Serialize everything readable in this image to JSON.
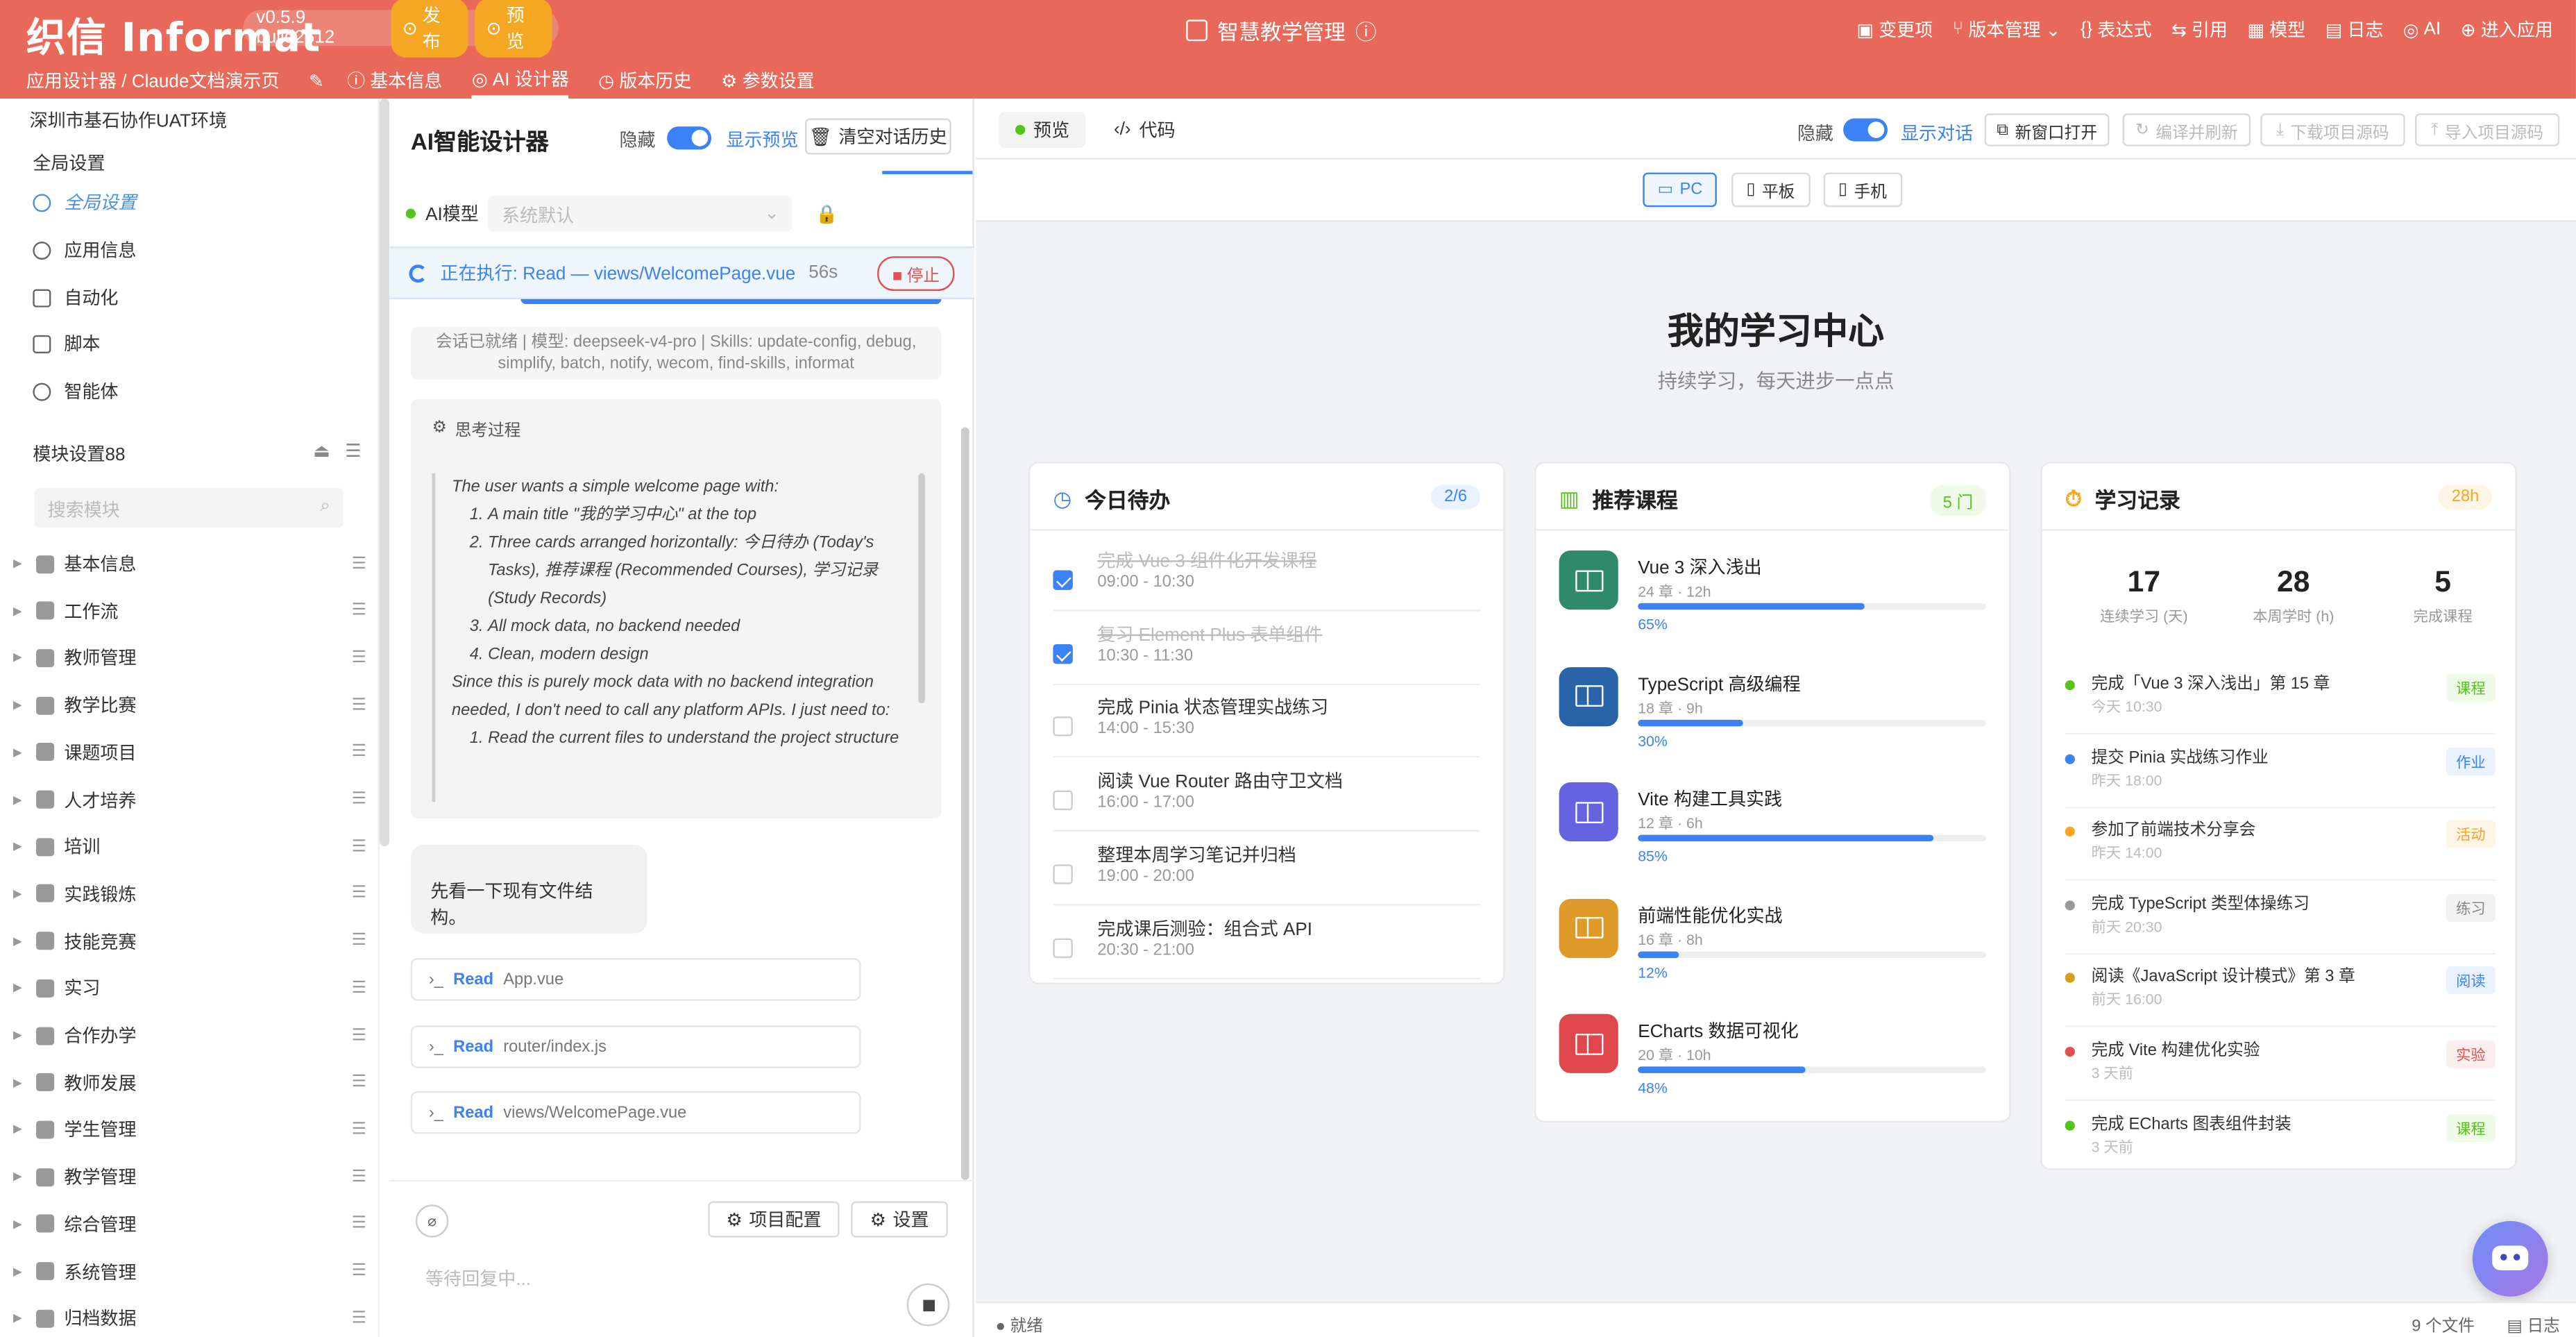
{
  "topbar": {
    "logo": "织信 Informat",
    "version": "v0.5.9 build2512",
    "publish": "发布",
    "preview": "预览",
    "app_title": "智慧教学管理",
    "nav": [
      "变更项",
      "版本管理",
      "表达式",
      "引用",
      "模型",
      "日志",
      "AI",
      "进入应用"
    ],
    "breadcrumb": "应用设计器 / Claude文档演示页",
    "subtabs": [
      "基本信息",
      "AI 设计器",
      "版本历史",
      "参数设置"
    ]
  },
  "sidebar": {
    "env": "深圳市基石协作UAT环境",
    "global_section": "全局设置",
    "items": [
      "全局设置",
      "应用信息",
      "自动化",
      "脚本",
      "智能体"
    ],
    "module_header": "模块设置88",
    "search_placeholder": "搜索模块",
    "modules": [
      "基本信息",
      "工作流",
      "教师管理",
      "教学比赛",
      "课题项目",
      "人才培养",
      "培训",
      "实践锻炼",
      "技能竞赛",
      "实习",
      "合作办学",
      "教师发展",
      "学生管理",
      "教学管理",
      "综合管理",
      "系统管理",
      "归档数据"
    ]
  },
  "ai_panel": {
    "title": "AI智能设计器",
    "hide_label": "隐藏",
    "show_preview": "显示预览",
    "clear_history": "清空对话历史",
    "model_label": "AI模型",
    "model_value": "系统默认",
    "exec_text": "正在执行: Read — views/WelcomePage.vue",
    "exec_time": "56s",
    "stop": "停止",
    "session_ready": "会话已就绪 | 模型: deepseek-v4-pro | Skills: update-config, debug, simplify, batch, notify, wecom, find-skills, informat",
    "thinking_title": "思考过程",
    "thinking_intro": "The user wants a simple welcome page with:",
    "thinking_points": [
      "A main title \"我的学习中心\" at the top",
      "Three cards arranged horizontally: 今日待办 (Today's Tasks), 推荐课程 (Recommended Courses), 学习记录 (Study Records)",
      "All mock data, no backend needed",
      "Clean, modern design"
    ],
    "thinking_mid": "Since this is purely mock data with no backend integration needed, I don't need to call any platform APIs. I just need to:",
    "thinking_steps": [
      "Read the current files to understand the project structure"
    ],
    "assistant_msg": "先看一下现有文件结构。",
    "tools": [
      {
        "action": "Read",
        "path": "App.vue"
      },
      {
        "action": "Read",
        "path": "router/index.js"
      },
      {
        "action": "Read",
        "path": "views/WelcomePage.vue"
      }
    ],
    "project_config": "项目配置",
    "settings": "设置",
    "input_placeholder": "等待回复中..."
  },
  "preview": {
    "tab_preview": "预览",
    "tab_code": "代码",
    "hide_label": "隐藏",
    "show_chat": "显示对话",
    "new_window": "新窗口打开",
    "compile": "编译并刷新",
    "download": "下载项目源码",
    "import": "导入项目源码",
    "devices": [
      "PC",
      "平板",
      "手机"
    ],
    "page_title": "我的学习中心",
    "page_subtitle": "持续学习，每天进步一点点",
    "status_left": "就绪",
    "status_files": "9 个文件",
    "status_log": "日志"
  },
  "cards": {
    "todo": {
      "title": "今日待办",
      "badge": "2/6",
      "items": [
        {
          "text": "完成 Vue 3 组件化开发课程",
          "time": "09:00 - 10:30",
          "done": true
        },
        {
          "text": "复习 Element Plus 表单组件",
          "time": "10:30 - 11:30",
          "done": true
        },
        {
          "text": "完成 Pinia 状态管理实战练习",
          "time": "14:00 - 15:30",
          "done": false
        },
        {
          "text": "阅读 Vue Router 路由守卫文档",
          "time": "16:00 - 17:00",
          "done": false
        },
        {
          "text": "整理本周学习笔记并归档",
          "time": "19:00 - 20:00",
          "done": false
        },
        {
          "text": "完成课后测验：组合式 API",
          "time": "20:30 - 21:00",
          "done": false
        }
      ]
    },
    "courses": {
      "title": "推荐课程",
      "badge": "5 门",
      "items": [
        {
          "name": "Vue 3 深入浅出",
          "meta": "24 章 · 12h",
          "progress": 65,
          "pct": "65%",
          "color": "#2f8a6b"
        },
        {
          "name": "TypeScript 高级编程",
          "meta": "18 章 · 9h",
          "progress": 30,
          "pct": "30%",
          "color": "#2a64a8"
        },
        {
          "name": "Vite 构建工具实践",
          "meta": "12 章 · 6h",
          "progress": 85,
          "pct": "85%",
          "color": "#6563e0"
        },
        {
          "name": "前端性能优化实战",
          "meta": "16 章 · 8h",
          "progress": 12,
          "pct": "12%",
          "color": "#e09a2a"
        },
        {
          "name": "ECharts 数据可视化",
          "meta": "20 章 · 10h",
          "progress": 48,
          "pct": "48%",
          "color": "#e0474d"
        }
      ]
    },
    "records": {
      "title": "学习记录",
      "badge": "28h",
      "stats": [
        {
          "num": "17",
          "label": "连续学习 (天)"
        },
        {
          "num": "28",
          "label": "本周学时 (h)"
        },
        {
          "num": "5",
          "label": "完成课程"
        }
      ],
      "items": [
        {
          "text": "完成「Vue 3 深入浅出」第 15 章",
          "time": "今天 10:30",
          "tag": "课程",
          "dot": "#52c41a",
          "tagc": "#52c41a",
          "tagbg": "#effbe8"
        },
        {
          "text": "提交 Pinia 实战练习作业",
          "time": "昨天 18:00",
          "tag": "作业",
          "dot": "#3b82f6",
          "tagc": "#3b82f6",
          "tagbg": "#eaf2ff"
        },
        {
          "text": "参加了前端技术分享会",
          "time": "昨天 14:00",
          "tag": "活动",
          "dot": "#f5a623",
          "tagc": "#f5a623",
          "tagbg": "#fff5e6"
        },
        {
          "text": "完成 TypeScript 类型体操练习",
          "time": "前天 20:30",
          "tag": "练习",
          "dot": "#999999",
          "tagc": "#888888",
          "tagbg": "#f2f2f2"
        },
        {
          "text": "阅读《JavaScript 设计模式》第 3 章",
          "time": "前天 16:00",
          "tag": "阅读",
          "dot": "#d4a017",
          "tagc": "#3b82f6",
          "tagbg": "#eaf2ff"
        },
        {
          "text": "完成 Vite 构建优化实验",
          "time": "3 天前",
          "tag": "实验",
          "dot": "#e05050",
          "tagc": "#e05050",
          "tagbg": "#fdeeee"
        },
        {
          "text": "完成 ECharts 图表组件封装",
          "time": "3 天前",
          "tag": "课程",
          "dot": "#52c41a",
          "tagc": "#52c41a",
          "tagbg": "#effbe8"
        }
      ]
    }
  },
  "colors": {
    "brand": "#e8695a",
    "accent": "#3b82f6"
  }
}
